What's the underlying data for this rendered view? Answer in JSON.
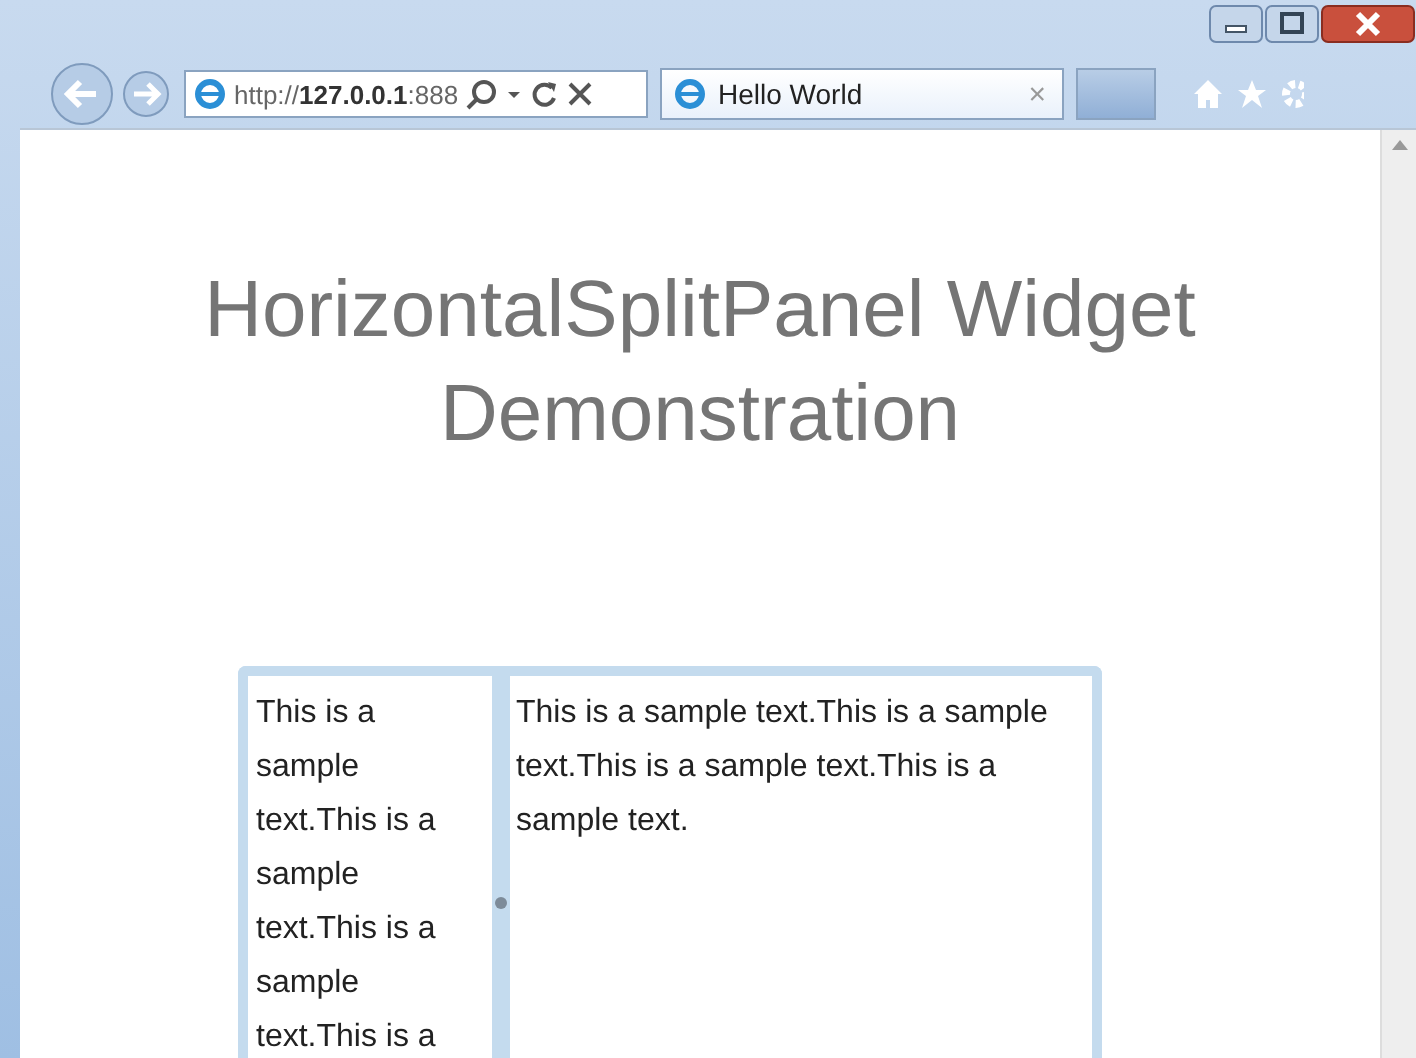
{
  "browser": {
    "address": "http://**127.0.0.1**:888",
    "tab": {
      "title": "Hello World",
      "close": "×",
      "selected": true
    }
  },
  "page": {
    "heading": "HorizontalSplitPanel Widget Demonstration",
    "split_panel": {
      "left_text": "This is a sample text.This is a sample text.This is a sample text.This is a",
      "right_text": "This is a sample text.This is a sample text.This is a sample text.This is a sample text."
    }
  }
}
